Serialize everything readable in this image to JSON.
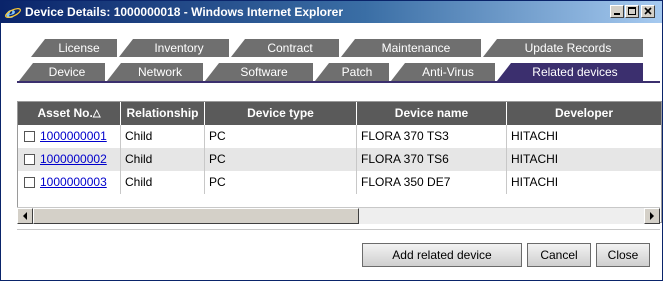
{
  "window": {
    "title": "Device Details: 1000000018 - Windows Internet Explorer"
  },
  "tabs": {
    "row1": [
      "License",
      "Inventory",
      "Contract",
      "Maintenance",
      "Update Records"
    ],
    "row2": [
      "Device",
      "Network",
      "Software",
      "Patch",
      "Anti-Virus",
      "Related devices"
    ],
    "active": "Related devices"
  },
  "table": {
    "columns": [
      "Asset No.",
      "Relationship",
      "Device type",
      "Device name",
      "Developer"
    ],
    "sort_indicator": "△",
    "rows": [
      {
        "asset_no": "1000000001",
        "relationship": "Child",
        "device_type": "PC",
        "device_name": "FLORA 370 TS3",
        "developer": "HITACHI"
      },
      {
        "asset_no": "1000000002",
        "relationship": "Child",
        "device_type": "PC",
        "device_name": "FLORA 370 TS6",
        "developer": "HITACHI"
      },
      {
        "asset_no": "1000000003",
        "relationship": "Child",
        "device_type": "PC",
        "device_name": "FLORA 350 DE7",
        "developer": "HITACHI"
      }
    ]
  },
  "buttons": {
    "add_related": "Add related device",
    "cancel": "Cancel",
    "close": "Close"
  },
  "colors": {
    "tab_inactive": "#6f6f6f",
    "tab_active": "#3b2f6e",
    "header_bg": "#5a5a5a",
    "link": "#0000cc"
  }
}
